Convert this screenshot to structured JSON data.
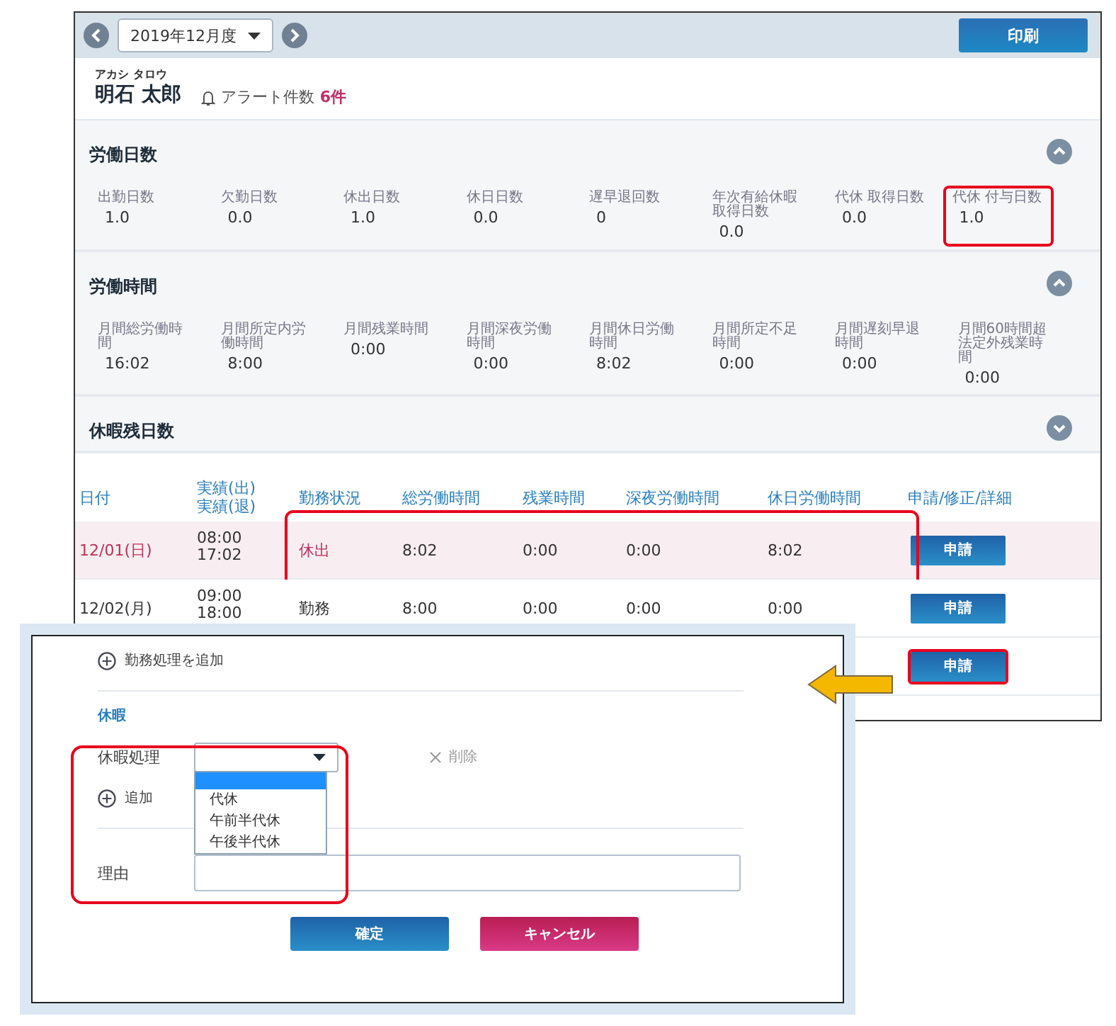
{
  "toolbar": {
    "period": "2019年12月度",
    "print_button": "印刷"
  },
  "employee": {
    "furigana": "アカシ タロウ",
    "name": "明石 太郎",
    "alert_label": "アラート件数",
    "alert_count": "6件"
  },
  "sections": [
    {
      "title": "労働日数",
      "expanded": true,
      "stats": [
        {
          "label": "出勤日数",
          "value": "1.0",
          "highlighted": false
        },
        {
          "label": "欠勤日数",
          "value": "0.0",
          "highlighted": false
        },
        {
          "label": "休出日数",
          "value": "1.0",
          "highlighted": false
        },
        {
          "label": "休日日数",
          "value": "0.0",
          "highlighted": false
        },
        {
          "label": "遅早退回数",
          "value": "0",
          "highlighted": false
        },
        {
          "label": "年次有給休暇取得日数",
          "value": "0.0",
          "highlighted": false
        },
        {
          "label": "代休 取得日数",
          "value": "0.0",
          "highlighted": false
        },
        {
          "label": "代休 付与日数",
          "value": "1.0",
          "highlighted": true
        }
      ]
    },
    {
      "title": "労働時間",
      "expanded": true,
      "stats": [
        {
          "label": "月間総労働時間",
          "value": "16:02",
          "highlighted": false
        },
        {
          "label": "月間所定内労働時間",
          "value": "8:00",
          "highlighted": false
        },
        {
          "label": "月間残業時間",
          "value": "0:00",
          "highlighted": false
        },
        {
          "label": "月間深夜労働時間",
          "value": "0:00",
          "highlighted": false
        },
        {
          "label": "月間休日労働時間",
          "value": "8:02",
          "highlighted": false
        },
        {
          "label": "月間所定不足時間",
          "value": "0:00",
          "highlighted": false
        },
        {
          "label": "月間遅刻早退時間",
          "value": "0:00",
          "highlighted": false
        },
        {
          "label": "月間60時間超法定外残業時間",
          "value": "0:00",
          "highlighted": false
        }
      ]
    },
    {
      "title": "休暇残日数",
      "expanded": false
    }
  ],
  "table": {
    "columns": [
      "日付",
      "実績(出)\n実績(退)",
      "勤務状況",
      "総労働時間",
      "残業時間",
      "深夜労働時間",
      "休日労働時間",
      "申請/修正/詳細"
    ],
    "rows": [
      {
        "date": "12/01(日)",
        "clock_in": "08:00",
        "clock_out": "17:02",
        "status": "休出",
        "total": "8:02",
        "overtime": "0:00",
        "night": "0:00",
        "holiday_work": "8:02",
        "button": "申請",
        "holiday": true,
        "highlighted": true,
        "button_highlighted": false
      },
      {
        "date": "12/02(月)",
        "clock_in": "09:00",
        "clock_out": "18:00",
        "status": "勤務",
        "total": "8:00",
        "overtime": "0:00",
        "night": "0:00",
        "holiday_work": "0:00",
        "button": "申請",
        "holiday": false,
        "highlighted": false,
        "button_highlighted": false
      },
      {
        "button": "申請",
        "holiday": false,
        "highlighted": false,
        "button_highlighted": true
      }
    ]
  },
  "dialog": {
    "add_work_link": "勤務処理を追加",
    "leave_heading": "休暇",
    "leave_label": "休暇処理",
    "blank_option_selected": true,
    "options": [
      {
        "label": "代休",
        "selected": false
      },
      {
        "label": "午前半代休",
        "selected": false
      },
      {
        "label": "午後半代休",
        "selected": false
      }
    ],
    "delete_link": "削除",
    "add_link": "追加",
    "reason_label": "理由",
    "confirm_button": "確定",
    "cancel_button": "キャンセル",
    "highlighted": true
  }
}
